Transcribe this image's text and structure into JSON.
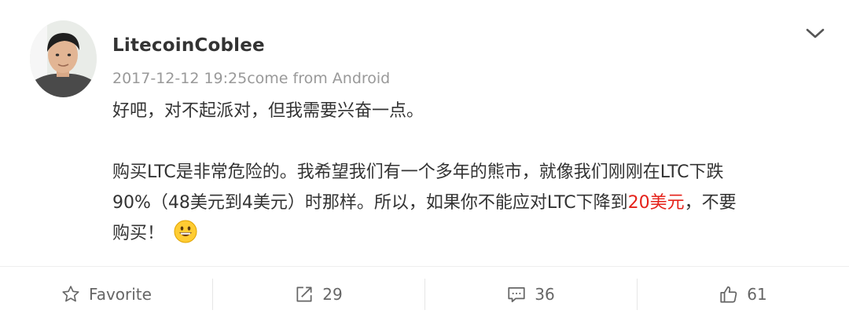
{
  "post": {
    "author": "LitecoinCoblee",
    "meta": "2017-12-12 19:25come from Android",
    "paragraph1": "好吧，对不起派对，但我需要兴奋一点。",
    "paragraph2": {
      "line1": "购买LTC是非常危险的。我希望我们有一个多年的熊市，就像我们刚刚在LTC下跌",
      "line2_before": "90%（48美元到4美元）时那样。所以，如果你不能应对LTC下降到",
      "line2_highlight": "20美元",
      "line2_after": "，不要",
      "line3": "购买！"
    },
    "emoji": "grinning-face",
    "highlight_color": "#e5221a"
  },
  "actions": {
    "favorite_label": "Favorite",
    "repost_count": "29",
    "comment_count": "36",
    "like_count": "61"
  },
  "icons": [
    "avatar-photo",
    "chevron-down-icon",
    "star-icon",
    "share-icon",
    "comment-icon",
    "thumbs-up-icon",
    "grinning-emoji-icon"
  ]
}
